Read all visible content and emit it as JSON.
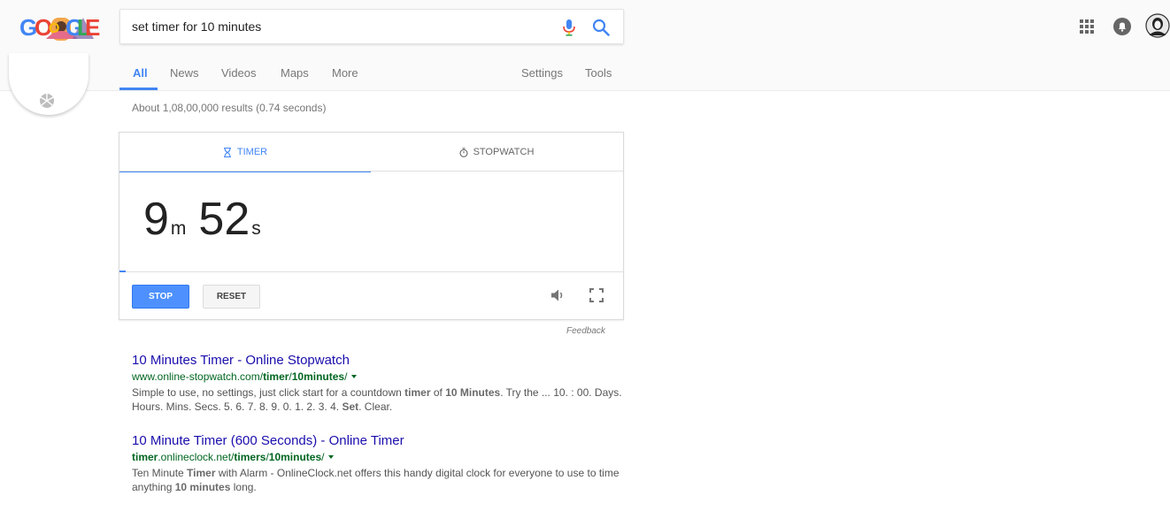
{
  "logo": {
    "letters": [
      {
        "char": "G",
        "color": "#4285f4"
      },
      {
        "char": "O",
        "color": "#ea4335"
      },
      {
        "char": "O",
        "color": "#fbbc05"
      },
      {
        "char": "G",
        "color": "#4285f4"
      },
      {
        "char": "L",
        "color": "#34a853"
      },
      {
        "char": "E",
        "color": "#ea4335"
      }
    ]
  },
  "search": {
    "query": "set timer for 10 minutes"
  },
  "tabs": [
    {
      "label": "All",
      "active": true
    },
    {
      "label": "News"
    },
    {
      "label": "Videos"
    },
    {
      "label": "Maps"
    },
    {
      "label": "More"
    },
    {
      "label": "Settings"
    },
    {
      "label": "Tools"
    }
  ],
  "result_stats": "About 1,08,00,000 results (0.74 seconds)",
  "timer_card": {
    "tab_timer": "TIMER",
    "tab_stopwatch": "STOPWATCH",
    "minutes": "9",
    "minutes_unit": "m",
    "seconds": "52",
    "seconds_unit": "s",
    "progress_fraction": 0.013,
    "stop_label": "STOP",
    "reset_label": "RESET"
  },
  "feedback": "Feedback",
  "results": [
    {
      "title": "10 Minutes Timer - Online Stopwatch",
      "url_plain_1": "www.online-stopwatch.com/",
      "url_bold_1": "timer",
      "url_plain_2": "/",
      "url_bold_2": "10minutes",
      "url_plain_3": "/",
      "snippet_1": "Simple to use, no settings, just click start for a countdown ",
      "snippet_b1": "timer",
      "snippet_2": " of ",
      "snippet_b2": "10 Minutes",
      "snippet_3": ". Try the ... 10. : 00. Days. Hours. Mins. Secs. 5. 6. 7. 8. 9. 0. 1. 2. 3. 4. ",
      "snippet_b3": "Set",
      "snippet_4": ". Clear."
    },
    {
      "title": "10 Minute Timer (600 Seconds) - Online Timer",
      "url_bold_0": "timer",
      "url_plain_1": ".onlineclock.net/",
      "url_bold_1": "timers",
      "url_plain_2": "/",
      "url_bold_2": "10minutes",
      "url_plain_3": "/",
      "snippet_1": "Ten Minute ",
      "snippet_b1": "Timer",
      "snippet_2": " with Alarm - OnlineClock.net offers this handy digital clock for everyone to use to time anything ",
      "snippet_b2": "10 minutes",
      "snippet_3": " long."
    }
  ],
  "colors": {
    "accent": "#4285f4",
    "link": "#1a0dab",
    "url": "#006621",
    "stop_button": "#4d90fe"
  }
}
